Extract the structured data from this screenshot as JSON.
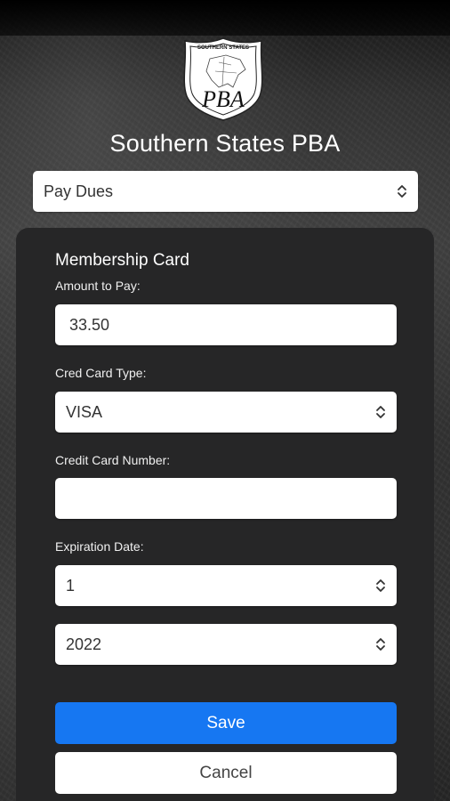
{
  "org": {
    "logo_text_top": "SOUTHERN STATES",
    "logo_letters": "PBA",
    "title": "Southern States PBA"
  },
  "action_select": {
    "value": "Pay Dues"
  },
  "form": {
    "title": "Membership Card",
    "amount": {
      "label": "Amount to Pay:",
      "value": "33.50"
    },
    "card_type": {
      "label": "Cred Card Type:",
      "value": "VISA"
    },
    "card_number": {
      "label": "Credit Card Number:",
      "value": ""
    },
    "expiration": {
      "label": "Expiration Date:",
      "month": "1",
      "year": "2022"
    }
  },
  "buttons": {
    "save": "Save",
    "cancel": "Cancel"
  },
  "colors": {
    "primary": "#1677f2",
    "card_bg": "#262627"
  }
}
